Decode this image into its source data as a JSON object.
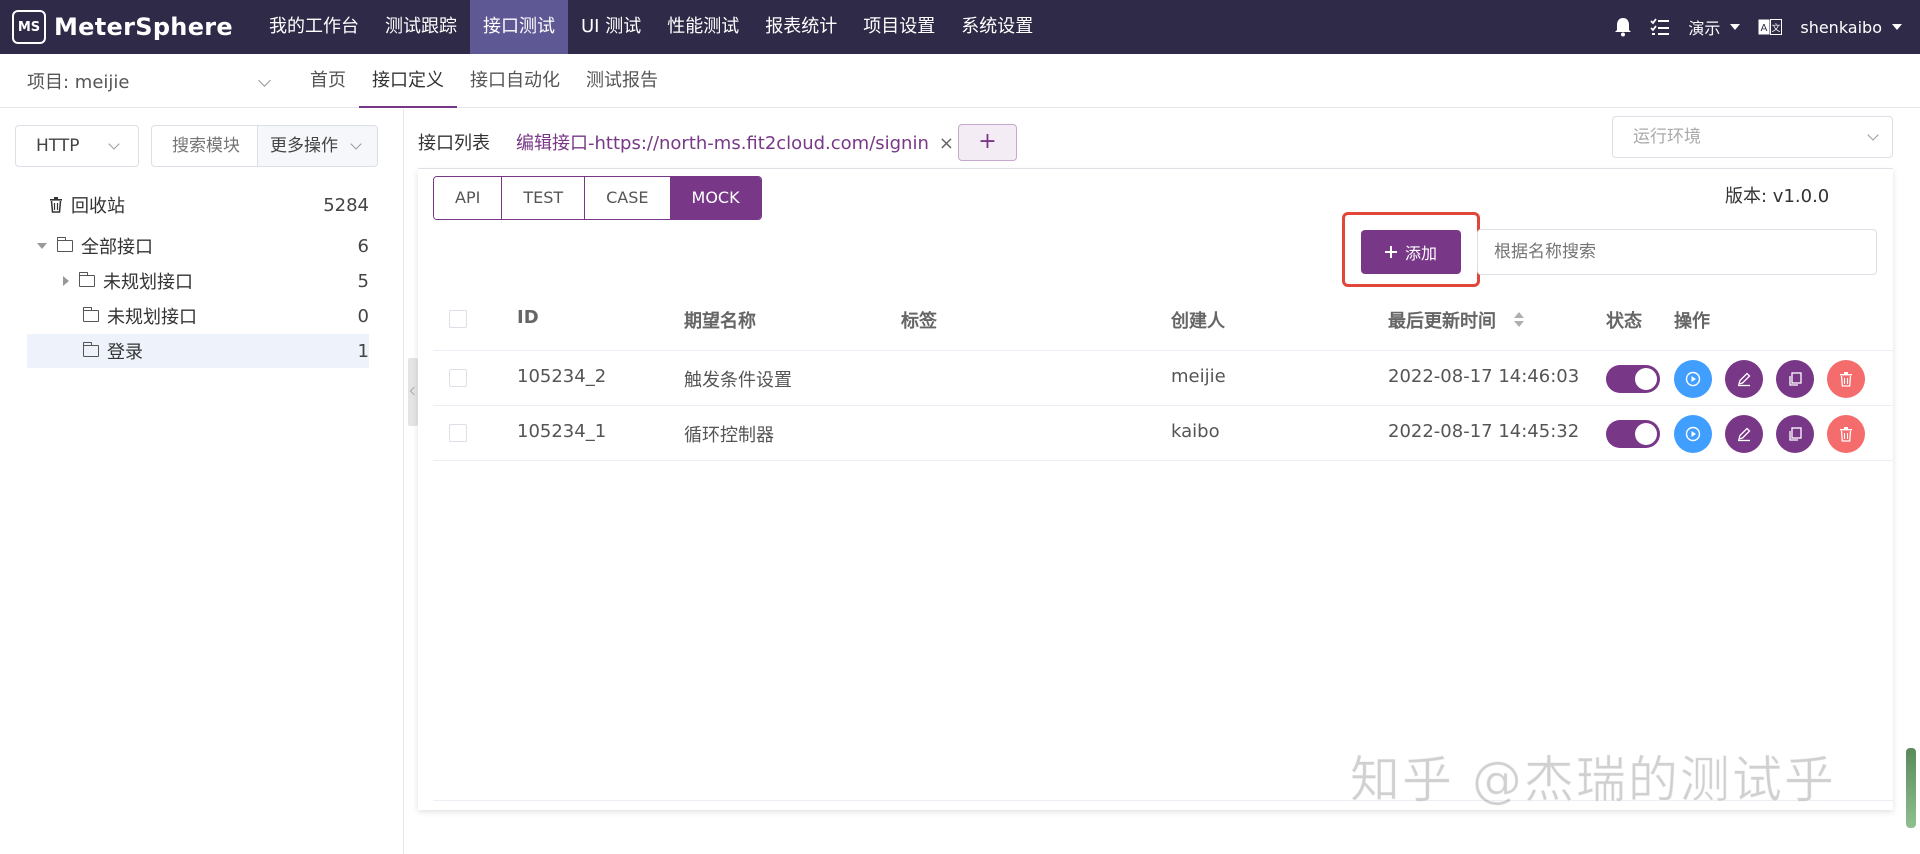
{
  "app": {
    "name": "MeterSphere",
    "logo_mark": "MS"
  },
  "topnav": {
    "items": [
      "我的工作台",
      "测试跟踪",
      "接口测试",
      "UI 测试",
      "性能测试",
      "报表统计",
      "项目设置",
      "系统设置"
    ],
    "active": "接口测试"
  },
  "topright": {
    "workspace": "演示",
    "user": "shenkaibo"
  },
  "subheader": {
    "project_label": "项目: meijie",
    "items": [
      "首页",
      "接口定义",
      "接口自动化",
      "测试报告"
    ],
    "active": "接口定义"
  },
  "sidebar": {
    "protocol": "HTTP",
    "search_placeholder": "搜索模块",
    "more_ops": "更多操作",
    "recycle": {
      "label": "回收站",
      "count": "5284"
    },
    "tree": [
      {
        "label": "全部接口",
        "count": "6"
      },
      {
        "label": "未规划接口",
        "count": "5"
      },
      {
        "label": "未规划接口",
        "count": "0"
      },
      {
        "label": "登录",
        "count": "1"
      }
    ]
  },
  "tabs": {
    "list": "接口列表",
    "edit": "编辑接口-https://north-ms.fit2cloud.com/signin",
    "add": "+"
  },
  "env_placeholder": "运行环境",
  "segments": [
    "API",
    "TEST",
    "CASE",
    "MOCK"
  ],
  "active_segment": "MOCK",
  "version": "版本: v1.0.0",
  "add_button": "添加",
  "name_search_placeholder": "根据名称搜索",
  "table": {
    "headers": [
      "ID",
      "期望名称",
      "标签",
      "创建人",
      "最后更新时间",
      "状态",
      "操作"
    ],
    "rows": [
      {
        "id": "105234_2",
        "name": "触发条件设置",
        "tag": "",
        "creator": "meijie",
        "updated": "2022-08-17 14:46:03",
        "enabled": true
      },
      {
        "id": "105234_1",
        "name": "循环控制器",
        "tag": "",
        "creator": "kaibo",
        "updated": "2022-08-17 14:45:32",
        "enabled": true
      }
    ]
  },
  "watermark": "知乎 @杰瑞的测试乎",
  "colors": {
    "topbar": "#2f2a47",
    "accent": "#783887",
    "run": "#409eff",
    "delete": "#f56c6c"
  }
}
